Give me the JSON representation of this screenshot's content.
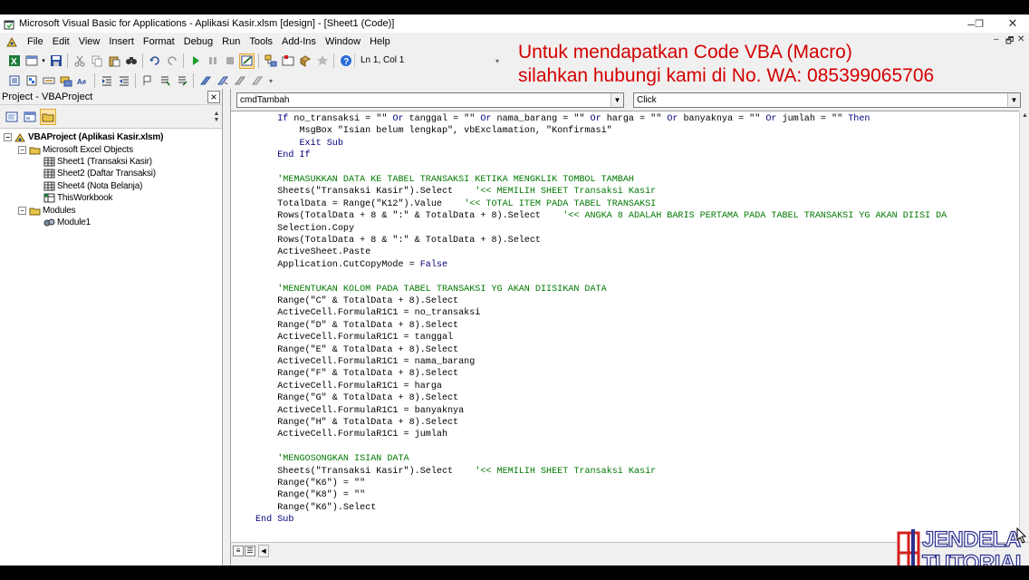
{
  "window": {
    "title": "Microsoft Visual Basic for Applications - Aplikasi Kasir.xlsm [design] - [Sheet1 (Code)]",
    "controls": [
      "–",
      "❐",
      "✕"
    ]
  },
  "menu": {
    "items": [
      "File",
      "Edit",
      "View",
      "Insert",
      "Format",
      "Debug",
      "Run",
      "Tools",
      "Add-Ins",
      "Window",
      "Help"
    ],
    "mdi_controls": [
      "–",
      "🗗",
      "✕"
    ]
  },
  "toolbar": {
    "status": "Ln 1, Col 1"
  },
  "promo": {
    "line1": "Untuk mendapatkan Code VBA (Macro)",
    "line2": "silahkan hubungi kami di No. WA: 085399065706"
  },
  "project": {
    "title": "Project - VBAProject",
    "tree": [
      {
        "label": "VBAProject (Aplikasi Kasir.xlsm)",
        "level": 0,
        "expander": "−",
        "icon": "vbaproject-icon",
        "bold": true
      },
      {
        "label": "Microsoft Excel Objects",
        "level": 1,
        "expander": "−",
        "icon": "folder-icon",
        "bold": false
      },
      {
        "label": "Sheet1 (Transaksi Kasir)",
        "level": 2,
        "expander": "",
        "icon": "sheet-icon",
        "bold": false
      },
      {
        "label": "Sheet2 (Daftar Transaksi)",
        "level": 2,
        "expander": "",
        "icon": "sheet-icon",
        "bold": false
      },
      {
        "label": "Sheet4 (Nota Belanja)",
        "level": 2,
        "expander": "",
        "icon": "sheet-icon",
        "bold": false
      },
      {
        "label": "ThisWorkbook",
        "level": 2,
        "expander": "",
        "icon": "workbook-icon",
        "bold": false
      },
      {
        "label": "Modules",
        "level": 1,
        "expander": "−",
        "icon": "folder-icon",
        "bold": false
      },
      {
        "label": "Module1",
        "level": 2,
        "expander": "",
        "icon": "module-icon",
        "bold": false
      }
    ]
  },
  "code": {
    "object_combo": "cmdTambah",
    "procedure_combo": "Click",
    "lines": [
      [
        {
          "t": "kw",
          "v": "    If "
        },
        {
          "t": "tx",
          "v": "no_transaksi = \"\" "
        },
        {
          "t": "kw",
          "v": "Or "
        },
        {
          "t": "tx",
          "v": "tanggal = \"\" "
        },
        {
          "t": "kw",
          "v": "Or "
        },
        {
          "t": "tx",
          "v": "nama_barang = \"\" "
        },
        {
          "t": "kw",
          "v": "Or "
        },
        {
          "t": "tx",
          "v": "harga = \"\" "
        },
        {
          "t": "kw",
          "v": "Or "
        },
        {
          "t": "tx",
          "v": "banyaknya = \"\" "
        },
        {
          "t": "kw",
          "v": "Or "
        },
        {
          "t": "tx",
          "v": "jumlah = \"\" "
        },
        {
          "t": "kw",
          "v": "Then"
        }
      ],
      [
        {
          "t": "tx",
          "v": "        MsgBox \"Isian belum lengkap\", vbExclamation, \"Konfirmasi\""
        }
      ],
      [
        {
          "t": "kw",
          "v": "        Exit Sub"
        }
      ],
      [
        {
          "t": "kw",
          "v": "    End If"
        }
      ],
      [
        {
          "t": "tx",
          "v": ""
        }
      ],
      [
        {
          "t": "cm",
          "v": "    'MEMASUKKAN DATA KE TABEL TRANSAKSI KETIKA MENGKLIK TOMBOL TAMBAH"
        }
      ],
      [
        {
          "t": "tx",
          "v": "    Sheets(\"Transaksi Kasir\").Select    "
        },
        {
          "t": "cm",
          "v": "'<< MEMILIH SHEET Transaksi Kasir"
        }
      ],
      [
        {
          "t": "tx",
          "v": "    TotalData = Range(\"K12\").Value    "
        },
        {
          "t": "cm",
          "v": "'<< TOTAL ITEM PADA TABEL TRANSAKSI"
        }
      ],
      [
        {
          "t": "tx",
          "v": "    Rows(TotalData + 8 & \":\" & TotalData + 8).Select    "
        },
        {
          "t": "cm",
          "v": "'<< ANGKA 8 ADALAH BARIS PERTAMA PADA TABEL TRANSAKSI YG AKAN DIISI DA"
        }
      ],
      [
        {
          "t": "tx",
          "v": "    Selection.Copy"
        }
      ],
      [
        {
          "t": "tx",
          "v": "    Rows(TotalData + 8 & \":\" & TotalData + 8).Select"
        }
      ],
      [
        {
          "t": "tx",
          "v": "    ActiveSheet.Paste"
        }
      ],
      [
        {
          "t": "tx",
          "v": "    Application.CutCopyMode = "
        },
        {
          "t": "kw",
          "v": "False"
        }
      ],
      [
        {
          "t": "tx",
          "v": ""
        }
      ],
      [
        {
          "t": "cm",
          "v": "    'MENENTUKAN KOLOM PADA TABEL TRANSAKSI YG AKAN DIISIKAN DATA"
        }
      ],
      [
        {
          "t": "tx",
          "v": "    Range(\"C\" & TotalData + 8).Select"
        }
      ],
      [
        {
          "t": "tx",
          "v": "    ActiveCell.FormulaR1C1 = no_transaksi"
        }
      ],
      [
        {
          "t": "tx",
          "v": "    Range(\"D\" & TotalData + 8).Select"
        }
      ],
      [
        {
          "t": "tx",
          "v": "    ActiveCell.FormulaR1C1 = tanggal"
        }
      ],
      [
        {
          "t": "tx",
          "v": "    Range(\"E\" & TotalData + 8).Select"
        }
      ],
      [
        {
          "t": "tx",
          "v": "    ActiveCell.FormulaR1C1 = nama_barang"
        }
      ],
      [
        {
          "t": "tx",
          "v": "    Range(\"F\" & TotalData + 8).Select"
        }
      ],
      [
        {
          "t": "tx",
          "v": "    ActiveCell.FormulaR1C1 = harga"
        }
      ],
      [
        {
          "t": "tx",
          "v": "    Range(\"G\" & TotalData + 8).Select"
        }
      ],
      [
        {
          "t": "tx",
          "v": "    ActiveCell.FormulaR1C1 = banyaknya"
        }
      ],
      [
        {
          "t": "tx",
          "v": "    Range(\"H\" & TotalData + 8).Select"
        }
      ],
      [
        {
          "t": "tx",
          "v": "    ActiveCell.FormulaR1C1 = jumlah"
        }
      ],
      [
        {
          "t": "tx",
          "v": ""
        }
      ],
      [
        {
          "t": "cm",
          "v": "    'MENGOSONGKAN ISIAN DATA"
        }
      ],
      [
        {
          "t": "tx",
          "v": "    Sheets(\"Transaksi Kasir\").Select    "
        },
        {
          "t": "cm",
          "v": "'<< MEMILIH SHEET Transaksi Kasir"
        }
      ],
      [
        {
          "t": "tx",
          "v": "    Range(\"K6\") = \"\""
        }
      ],
      [
        {
          "t": "tx",
          "v": "    Range(\"K8\") = \"\""
        }
      ],
      [
        {
          "t": "tx",
          "v": "    Range(\"K6\").Select"
        }
      ],
      [
        {
          "t": "kw",
          "v": "End Sub"
        }
      ]
    ]
  },
  "logo": {
    "line1": "JENDELA",
    "line2": "TUTORIAL"
  },
  "colors": {
    "keyword": "#00007a",
    "comment": "#007800",
    "promo": "#d40000",
    "logo_stroke": "#2b2f8f",
    "logo_red": "#d42020"
  }
}
